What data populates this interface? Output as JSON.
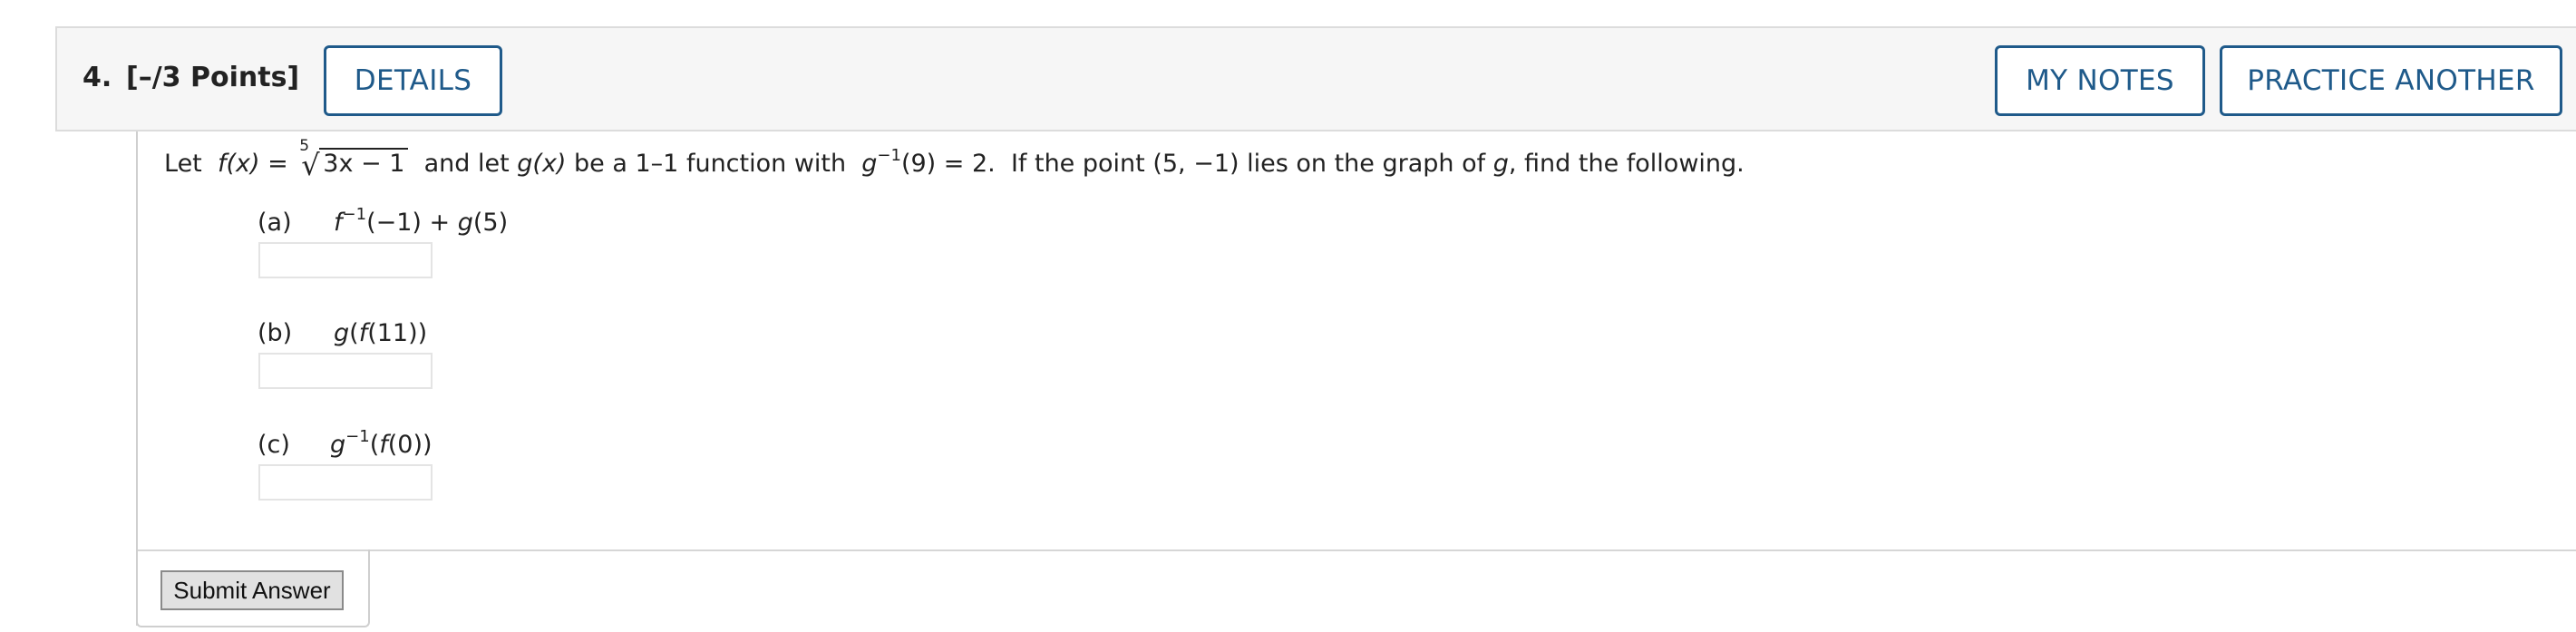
{
  "question": {
    "number": "4.",
    "points": "[–/3 Points]"
  },
  "buttons": {
    "details": "DETAILS",
    "my_notes": "MY NOTES",
    "practice_another": "PRACTICE ANOTHER",
    "submit": "Submit Answer"
  },
  "problem": {
    "let": "Let",
    "fx": "f(x) =",
    "root_index": "5",
    "radicand": "3x − 1",
    "and_let": "and let",
    "gx": "g(x)",
    "be_a": "be a 1–1 function with",
    "ginv": "g",
    "ginv_sup": "−1",
    "ginv_arg": "(9) = 2.",
    "if_point": "If the point (5, −1) lies on the graph of",
    "g": "g",
    "find": ", find the following."
  },
  "parts": [
    {
      "label": "(a)",
      "fname": "f",
      "sup": "−1",
      "rest": "(−1) + ",
      "gname": "g",
      "rest2": "(5)"
    },
    {
      "label": "(b)",
      "expr_g": "g",
      "expr_paren": "(",
      "expr_f": "f",
      "expr_rest": "(11))"
    },
    {
      "label": "(c)",
      "gname": "g",
      "sup": "−1",
      "open": "(",
      "fname": "f",
      "rest": "(0))"
    }
  ]
}
